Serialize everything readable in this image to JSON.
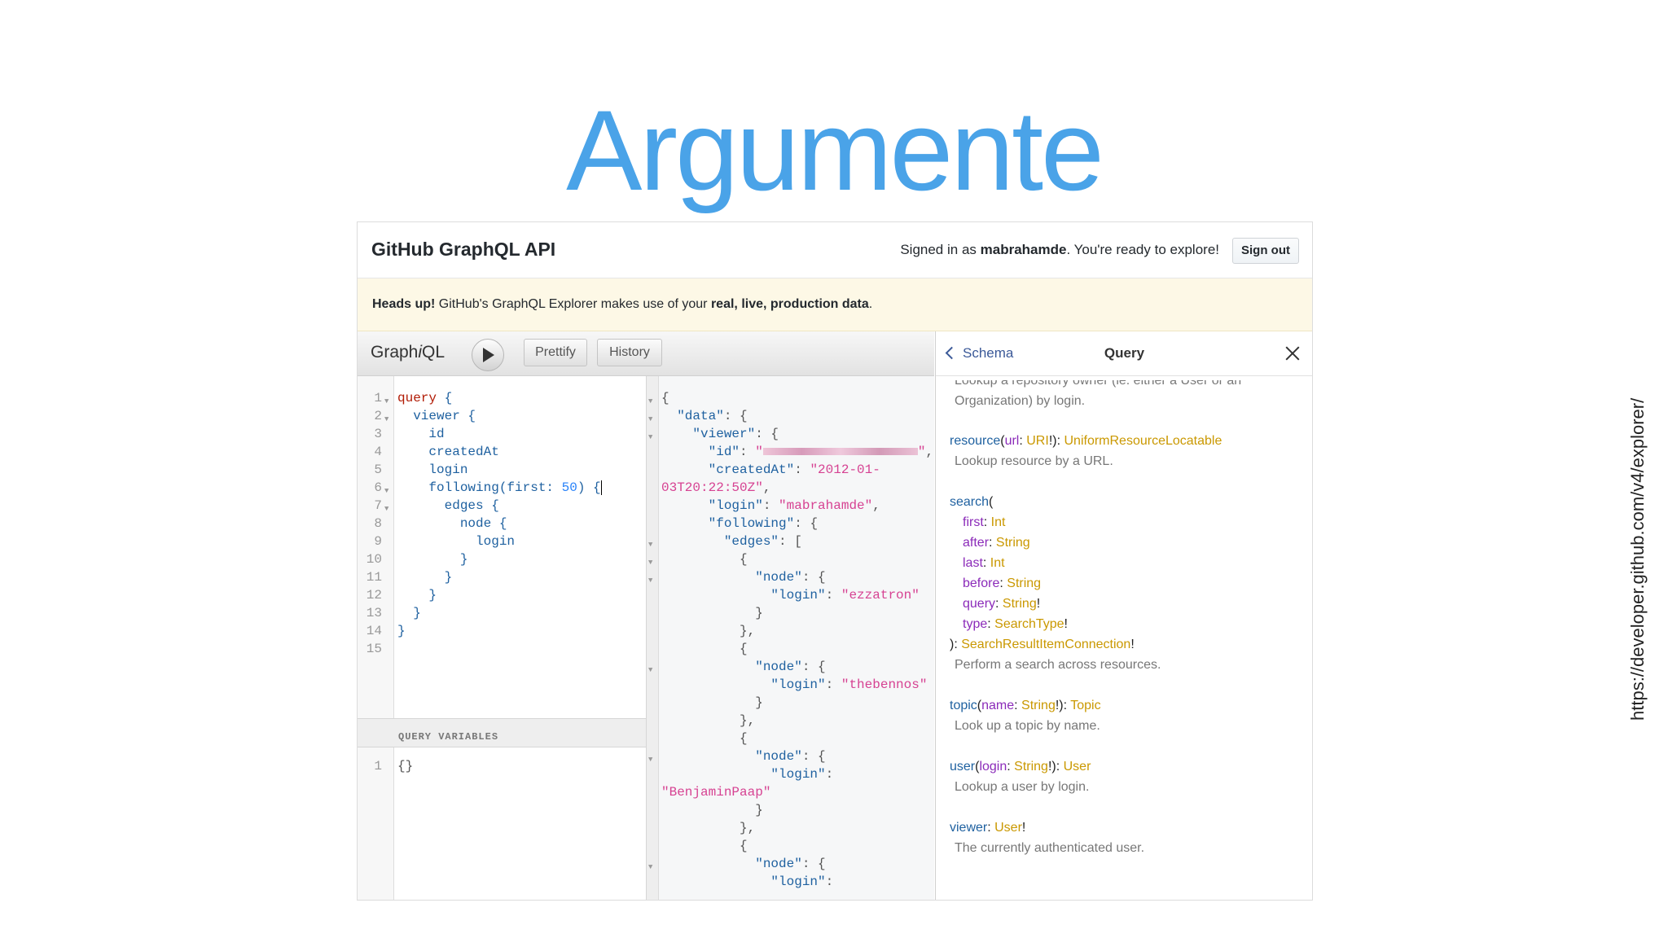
{
  "slide": {
    "title": "Argumente",
    "source_url": "https://developer.github.com/v4/explorer/"
  },
  "header": {
    "title": "GitHub GraphQL API",
    "signed_prefix": "Signed in as ",
    "username": "mabrahamde",
    "signed_suffix": ". You're ready to explore!",
    "sign_out": "Sign out"
  },
  "notice": {
    "bold1": "Heads up!",
    "text1": " GitHub's GraphQL Explorer makes use of your ",
    "bold2": "real, live, production data",
    "text2": "."
  },
  "toolbar": {
    "brand_a": "Graph",
    "brand_i": "i",
    "brand_b": "QL",
    "prettify": "Prettify",
    "history": "History"
  },
  "editor": {
    "line_numbers": [
      "1",
      "2",
      "3",
      "4",
      "5",
      "6",
      "7",
      "8",
      "9",
      "10",
      "11",
      "12",
      "13",
      "14",
      "15"
    ],
    "lines": {
      "l1_kw": "query",
      "l1": " {",
      "l2": "  viewer {",
      "l3": "    id",
      "l4": "    createdAt",
      "l5": "    login",
      "l6a": "    following(first: ",
      "l6n": "50",
      "l6b": ") {",
      "l7": "      edges {",
      "l8": "        node {",
      "l9": "          login",
      "l10": "        }",
      "l11": "      }",
      "l12": "    }",
      "l13": "  }",
      "l14": "}"
    }
  },
  "variables": {
    "header": "QUERY VARIABLES",
    "line": "1",
    "value": "{}"
  },
  "result": {
    "open": "{",
    "data_key": "\"data\"",
    "viewer_key": "\"viewer\"",
    "id_key": "\"id\"",
    "created_key": "\"createdAt\"",
    "created_val_a": "\"2012-01-",
    "created_val_b": "03T20:22:50Z\"",
    "login_key": "\"login\"",
    "login_val": "\"mabrahamde\"",
    "following_key": "\"following\"",
    "edges_key": "\"edges\"",
    "node_key": "\"node\"",
    "login1": "\"ezzatron\"",
    "login2": "\"thebennos\"",
    "login3": "\"BenjaminPaap\""
  },
  "docs": {
    "back": "Schema",
    "title": "Query",
    "cut_line": "Lookup a repository owner (ie. either a User or an",
    "cut_line2": "Organization) by login.",
    "resource_name": "resource",
    "resource_arg": "url",
    "resource_argtype": "URI",
    "resource_type": "UniformResourceLocatable",
    "resource_desc": "Lookup resource by a URL.",
    "search_name": "search",
    "search_args": [
      {
        "name": "first",
        "type": "Int",
        "bang": ""
      },
      {
        "name": "after",
        "type": "String",
        "bang": ""
      },
      {
        "name": "last",
        "type": "Int",
        "bang": ""
      },
      {
        "name": "before",
        "type": "String",
        "bang": ""
      },
      {
        "name": "query",
        "type": "String",
        "bang": "!"
      },
      {
        "name": "type",
        "type": "SearchType",
        "bang": "!"
      }
    ],
    "search_type": "SearchResultItemConnection",
    "search_desc": "Perform a search across resources.",
    "topic_name": "topic",
    "topic_arg": "name",
    "topic_argtype": "String",
    "topic_type": "Topic",
    "topic_desc": "Look up a topic by name.",
    "user_name": "user",
    "user_arg": "login",
    "user_argtype": "String",
    "user_type": "User",
    "user_desc": "Lookup a user by login.",
    "viewer_name": "viewer",
    "viewer_type": "User",
    "viewer_desc": "The currently authenticated user."
  }
}
